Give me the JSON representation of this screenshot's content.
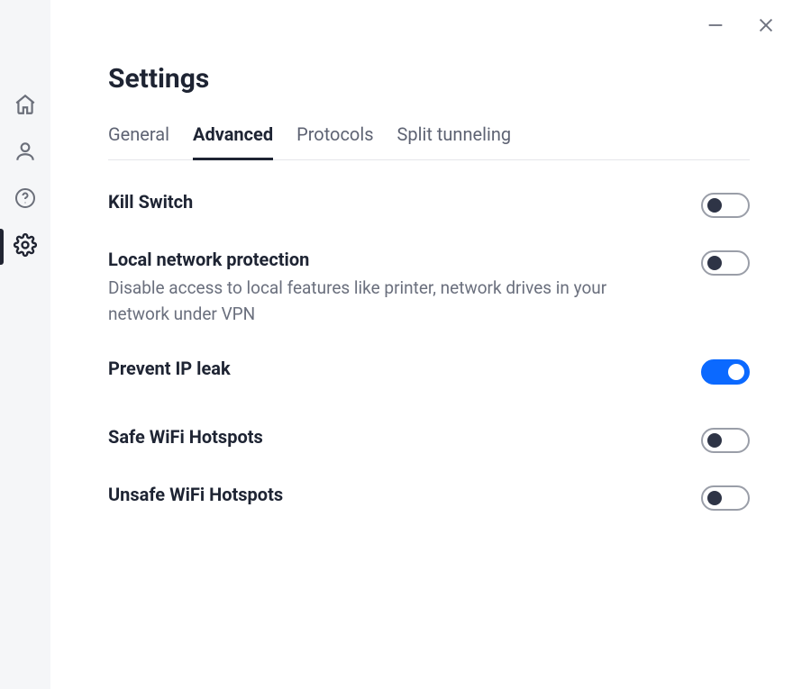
{
  "page": {
    "title": "Settings"
  },
  "tabs": [
    {
      "label": "General",
      "active": false
    },
    {
      "label": "Advanced",
      "active": true
    },
    {
      "label": "Protocols",
      "active": false
    },
    {
      "label": "Split tunneling",
      "active": false
    }
  ],
  "sidebar": {
    "items": [
      {
        "name": "home",
        "icon": "home-icon",
        "active": false
      },
      {
        "name": "account",
        "icon": "user-icon",
        "active": false
      },
      {
        "name": "help",
        "icon": "help-icon",
        "active": false
      },
      {
        "name": "settings",
        "icon": "gear-icon",
        "active": true
      }
    ]
  },
  "settings": [
    {
      "key": "kill_switch",
      "title": "Kill Switch",
      "desc": "",
      "on": false
    },
    {
      "key": "local_network_protection",
      "title": "Local network protection",
      "desc": "Disable access to local features like printer, network drives in your network under VPN",
      "on": false
    },
    {
      "key": "prevent_ip_leak",
      "title": "Prevent IP leak",
      "desc": "",
      "on": true
    },
    {
      "key": "safe_wifi_hotspots",
      "title": "Safe WiFi Hotspots",
      "desc": "",
      "on": false
    },
    {
      "key": "unsafe_wifi_hotspots",
      "title": "Unsafe WiFi Hotspots",
      "desc": "",
      "on": false
    }
  ],
  "colors": {
    "accent": "#0b69ff",
    "text_primary": "#1e2433",
    "text_secondary": "#6a6f7d"
  }
}
